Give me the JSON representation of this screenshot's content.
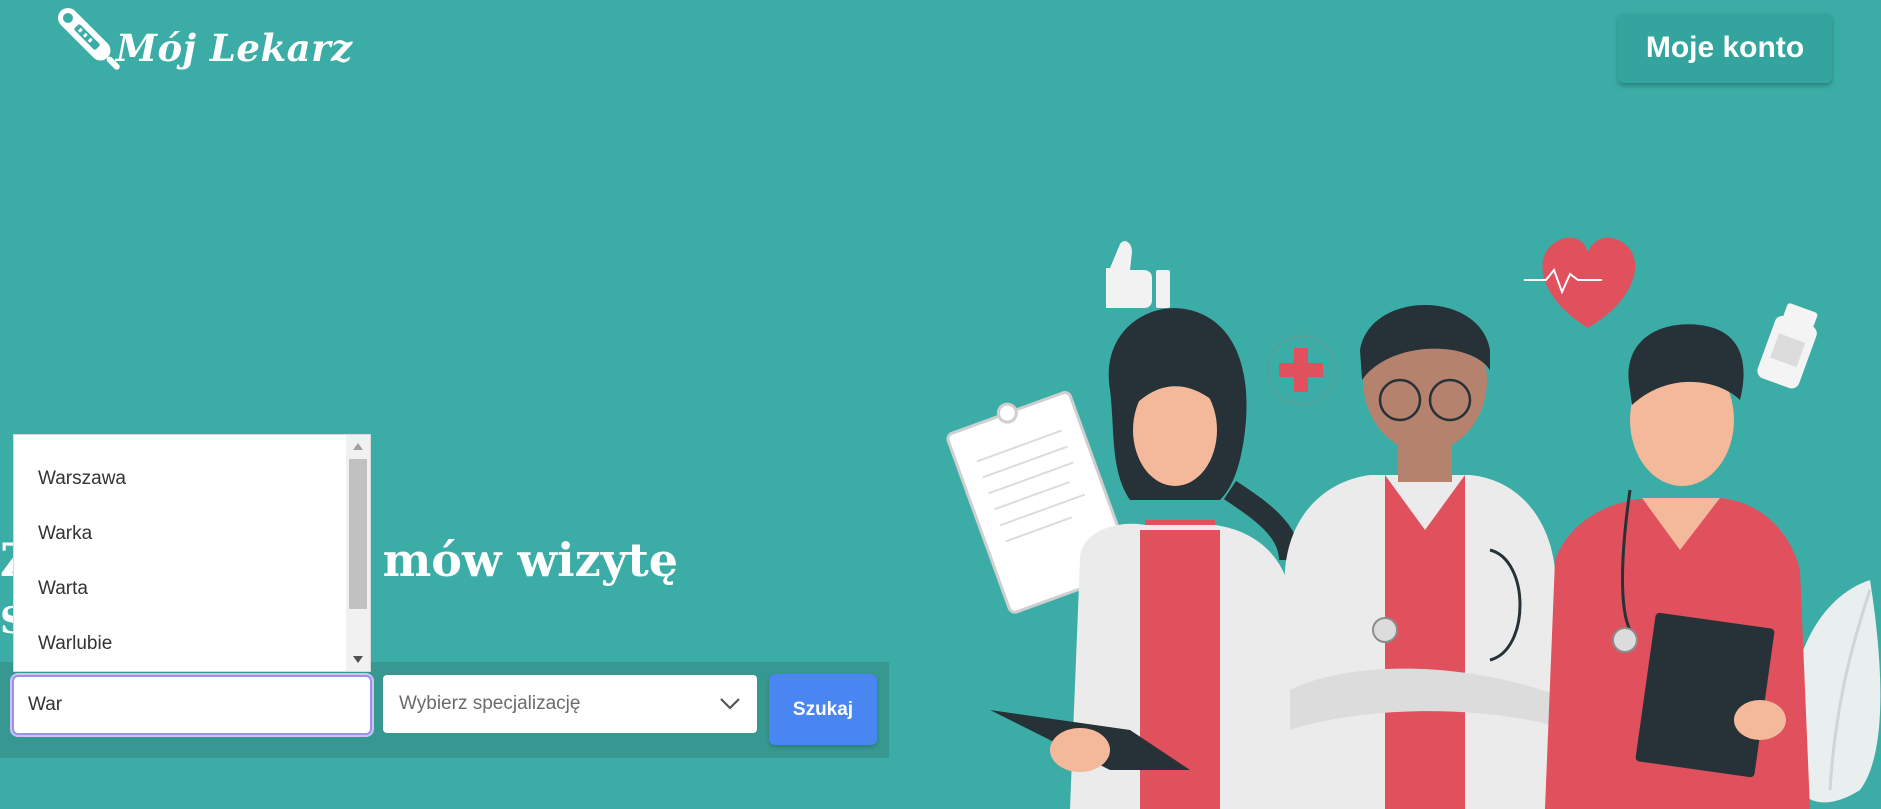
{
  "header": {
    "logo_text": "Mój Lekarz",
    "account_button": "Moje konto"
  },
  "hero": {
    "title_visible_left": "Z",
    "title_visible_right": "mów wizytę",
    "subtitle_visible": "S"
  },
  "search": {
    "city_value": "War",
    "specialization_placeholder": "Wybierz specjalizację",
    "search_button": "Szukaj",
    "suggestions": [
      "Warszawa",
      "Warka",
      "Warta",
      "Warlubie"
    ]
  },
  "colors": {
    "background": "#3cada6",
    "accent_button": "#4a86f2",
    "illustration_red": "#e0505d"
  },
  "icons": [
    "thermometer-icon",
    "chevron-down-icon",
    "thumbs-up-icon",
    "heart-icon",
    "medical-cross-icon",
    "pill-bottle-icon"
  ]
}
